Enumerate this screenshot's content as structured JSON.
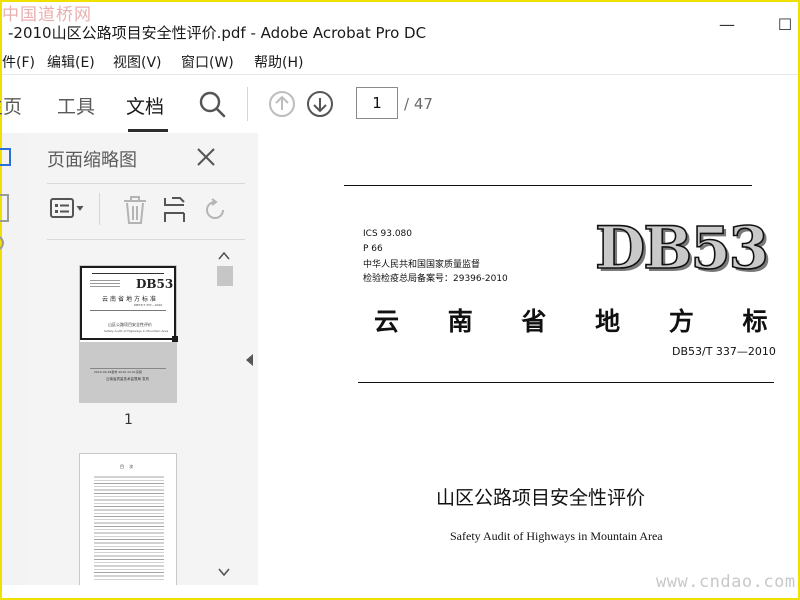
{
  "watermark": {
    "top": "中国道桥网",
    "bottom": "www.cndao.com"
  },
  "window": {
    "title": "-2010山区公路项目安全性评价.pdf - Adobe Acrobat Pro DC",
    "minimize_glyph": "—",
    "maximize_glyph": "☐"
  },
  "menu": [
    "件(F)",
    "编辑(E)",
    "视图(V)",
    "窗口(W)",
    "帮助(H)"
  ],
  "toolbar": {
    "tabs": [
      "主页",
      "工具",
      "文档"
    ],
    "active_tab": "文档",
    "current_page": "1",
    "total_pages": "/ 47"
  },
  "thumbnails_panel": {
    "title": "页面缩略图",
    "thumb1_label": "1",
    "thumb1": {
      "db": "DB53",
      "org": "云南省地方标准",
      "code": "DB53/T 337—2010",
      "title_cn": "山区公路项目安全性评价",
      "title_en": "Safety Audit of Highways in Mountain Area",
      "dates": "2010-09-28发布  2010-12-01实施",
      "issuer": "云南省质量技术监督局  发布"
    },
    "thumb2_heading": "目  次"
  },
  "document": {
    "ics": "ICS 93.080",
    "p": "P 66",
    "authority": "中华人民共和国国家质量监督",
    "record": "检验检疫总局备案号：29396-2010",
    "db_logo": "DB53",
    "org_title": "云 南 省 地 方 标 准",
    "standard_no": "DB53/T 337—2010",
    "title_cn": "山区公路项目安全性评价",
    "title_en": "Safety Audit of Highways in Mountain Area"
  },
  "colors": {
    "frame": "#f0e000",
    "panel_bg": "#f4f4f4",
    "text": "#1a1a1a"
  }
}
